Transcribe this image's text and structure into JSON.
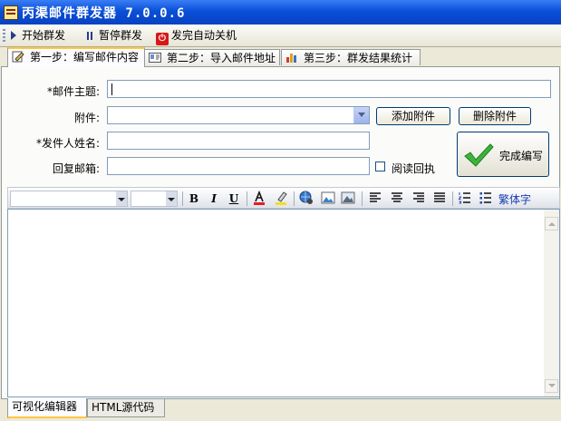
{
  "window": {
    "title": "丙渠邮件群发器 7.0.0.6"
  },
  "toolbar": {
    "start": "开始群发",
    "pause": "暂停群发",
    "shutdown": "发完自动关机"
  },
  "tabs": [
    {
      "label": "第一步：编写邮件内容"
    },
    {
      "label": "第二步：导入邮件地址"
    },
    {
      "label": "第三步：群发结果统计"
    }
  ],
  "form": {
    "subject_label": "*邮件主题:",
    "subject_value": "",
    "attachment_label": "附件:",
    "add_attachment": "添加附件",
    "delete_attachment": "删除附件",
    "sender_label": "*发件人姓名:",
    "sender_value": "",
    "reply_label": "回复邮箱:",
    "reply_value": "",
    "read_receipt": "阅读回执",
    "finish_button": "完成编写"
  },
  "editor_toolbar": {
    "bold": "B",
    "italic": "I",
    "underline": "U",
    "traditional": "繁体字"
  },
  "editor": {
    "content": ""
  },
  "bottom_tabs": [
    {
      "label": "可视化编辑器"
    },
    {
      "label": "HTML源代码"
    }
  ],
  "colors": {
    "titlebar": "#0a4fd8",
    "tab_highlight": "#ffc83c",
    "check_green": "#3cb43c",
    "power_red": "#d81818"
  }
}
